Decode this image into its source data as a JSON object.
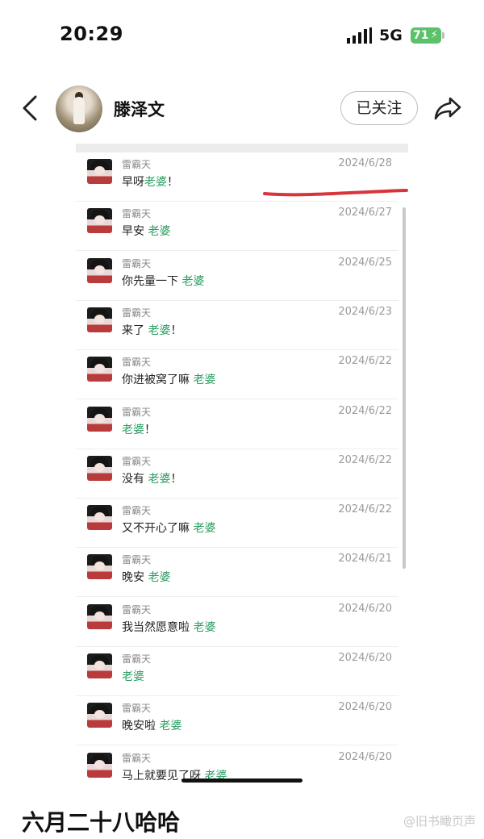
{
  "status_bar": {
    "time": "20:29",
    "network": "5G",
    "battery": "71"
  },
  "header": {
    "username": "滕泽文",
    "follow_label": "已关注"
  },
  "messages": [
    {
      "sender": "雷霸天",
      "date": "2024/6/28",
      "prefix": "早呀",
      "keyword": "老婆",
      "suffix": "！"
    },
    {
      "sender": "雷霸天",
      "date": "2024/6/27",
      "prefix": "早安 ",
      "keyword": "老婆",
      "suffix": ""
    },
    {
      "sender": "雷霸天",
      "date": "2024/6/25",
      "prefix": "你先量一下 ",
      "keyword": "老婆",
      "suffix": ""
    },
    {
      "sender": "雷霸天",
      "date": "2024/6/23",
      "prefix": "来了 ",
      "keyword": "老婆",
      "suffix": "！"
    },
    {
      "sender": "雷霸天",
      "date": "2024/6/22",
      "prefix": "你进被窝了嘛 ",
      "keyword": "老婆",
      "suffix": ""
    },
    {
      "sender": "雷霸天",
      "date": "2024/6/22",
      "prefix": "",
      "keyword": "老婆",
      "suffix": "！"
    },
    {
      "sender": "雷霸天",
      "date": "2024/6/22",
      "prefix": "没有 ",
      "keyword": "老婆",
      "suffix": "！"
    },
    {
      "sender": "雷霸天",
      "date": "2024/6/22",
      "prefix": "又不开心了嘛 ",
      "keyword": "老婆",
      "suffix": ""
    },
    {
      "sender": "雷霸天",
      "date": "2024/6/21",
      "prefix": "晚安 ",
      "keyword": "老婆",
      "suffix": ""
    },
    {
      "sender": "雷霸天",
      "date": "2024/6/20",
      "prefix": "我当然愿意啦 ",
      "keyword": "老婆",
      "suffix": ""
    },
    {
      "sender": "雷霸天",
      "date": "2024/6/20",
      "prefix": "",
      "keyword": "老婆",
      "suffix": ""
    },
    {
      "sender": "雷霸天",
      "date": "2024/6/20",
      "prefix": "晚安啦 ",
      "keyword": "老婆",
      "suffix": ""
    },
    {
      "sender": "雷霸天",
      "date": "2024/6/20",
      "prefix": "马上就要见了呀 ",
      "keyword": "老婆",
      "suffix": ""
    }
  ],
  "caption": "六月二十八哈哈",
  "watermark": "@旧书瞰页声",
  "colors": {
    "keyword_green": "#2e9e64",
    "annotation_red": "#d9343a",
    "battery_green": "#5cc26a"
  }
}
